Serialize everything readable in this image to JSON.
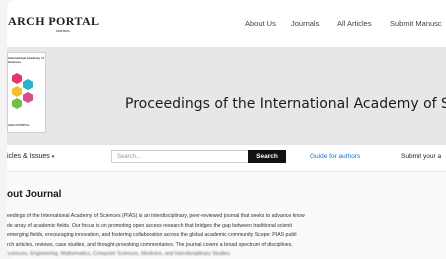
{
  "header": {
    "logo_text": "ARCH PORTAL",
    "logo_sub": "CENTRAL",
    "nav": [
      {
        "label": "About Us"
      },
      {
        "label": "Journals"
      },
      {
        "label": "All Articles"
      },
      {
        "label": "Submit Manusc"
      }
    ]
  },
  "hero": {
    "cover_title": "International Academy of Sciences",
    "cover_footer": "ARCH PORTAL",
    "journal_title": "Proceedings of the International Academy of Sc",
    "hex_colors": [
      "#e2386a",
      "#27b3c7",
      "#f2c12e",
      "#6fbf4a",
      "#d94c8c"
    ]
  },
  "toolbar": {
    "articles_menu": "icles & Issues",
    "search_placeholder": "Search...",
    "search_button": "Search",
    "guide_link": "Guide for authors",
    "submit_link": "Submit your a"
  },
  "about": {
    "heading": "out Journal",
    "lines": [
      "eedings of the International Academy of Sciences (PIAS) is an interdisciplinary, peer-reviewed journal that seeks to advance know",
      "de array of academic fields. Our focus is on promoting open access research that bridges the gap between traditional scienti",
      "emerging fields, encouraging innovation, and fostering collaboration across the global academic community Scope: PIAS publi",
      "rch articles, reviews, case studies, and thought-provoking commentaries. The journal covers a broad spectrum of disciplines,",
      "sciences, Engineering, Mathematics, Computer Sciences, Medicine, and Interdisciplinary Studies."
    ]
  }
}
